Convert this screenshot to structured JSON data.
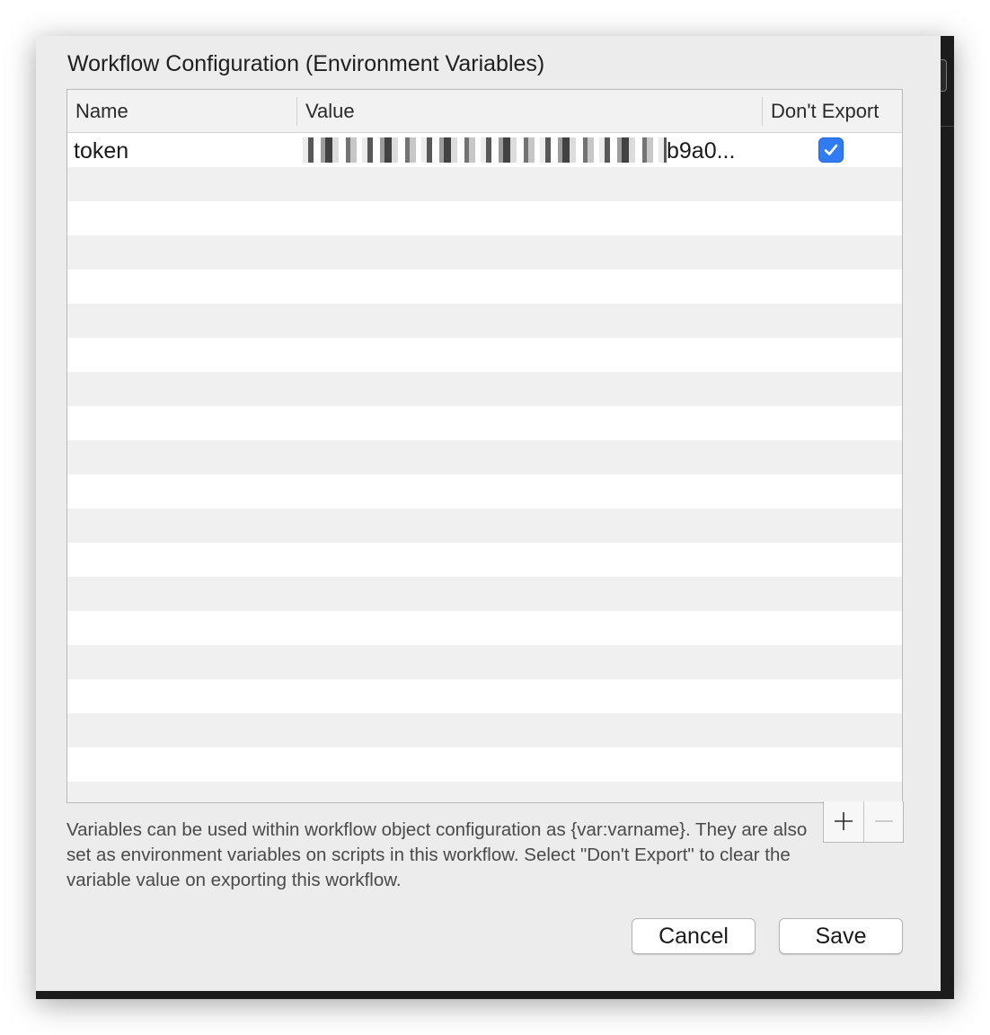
{
  "dialog": {
    "title": "Workflow Configuration (Environment Variables)"
  },
  "table": {
    "columns": {
      "name": "Name",
      "value": "Value",
      "dont_export": "Don't Export"
    },
    "rows": [
      {
        "name": "token",
        "value_visible_tail": "b9a0...",
        "value_redacted": true,
        "dont_export": true
      }
    ],
    "empty_rows": 19
  },
  "controls": {
    "add_symbol": "+",
    "remove_symbol": "−"
  },
  "info": {
    "text": "Variables can be used within workflow object configuration as {var:varname}. They are also set as environment variables on scripts in this workflow. Select \"Don't Export\" to clear the variable value on exporting this workflow."
  },
  "buttons": {
    "cancel": "Cancel",
    "save": "Save"
  },
  "colors": {
    "checkbox_accent": "#2f7cf6",
    "sheet_background": "#ececec",
    "row_stripe": "#f0f0f0"
  },
  "icons": {
    "checkmark": "checkmark-icon",
    "add": "plus-icon",
    "remove": "minus-icon"
  }
}
